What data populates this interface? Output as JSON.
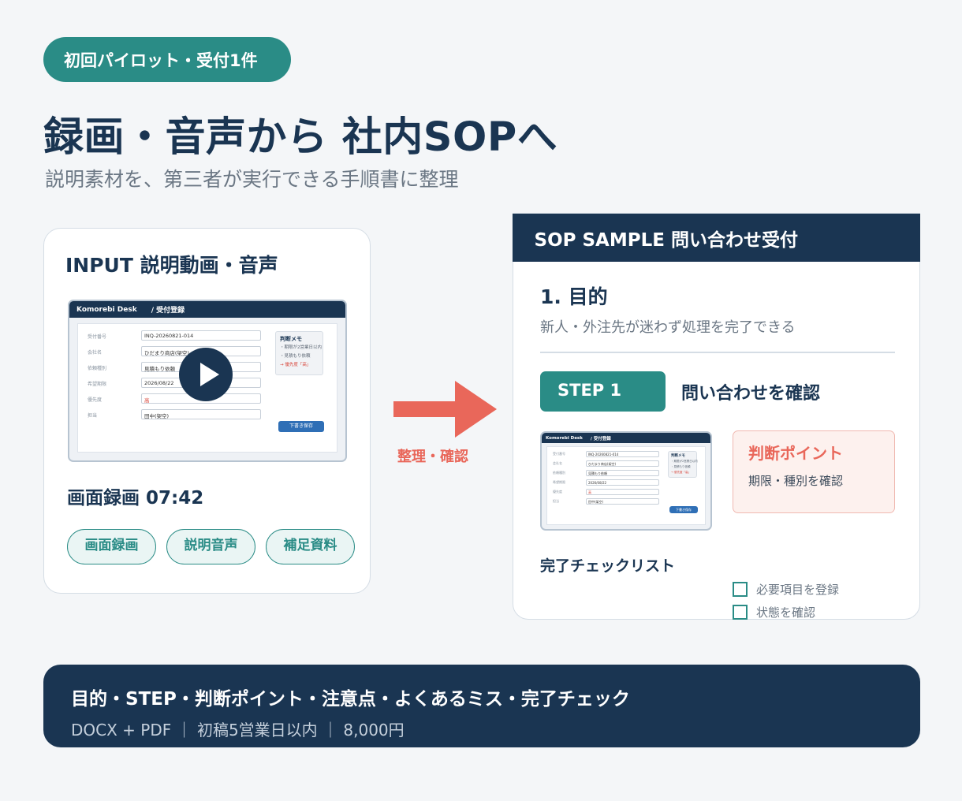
{
  "badge": "初回パイロット・受付1件",
  "headline": "録画・音声から 社内SOPへ",
  "subline": "説明素材を、第三者が実行できる手順書に整理",
  "input": {
    "title": "INPUT  説明動画・音声",
    "duration": "画面録画  07:42",
    "chips": [
      "画面録画",
      "説明音声",
      "補足資料"
    ]
  },
  "app_thumb": {
    "brand": "Komorebi Desk",
    "page": "/ 受付登録",
    "fields": [
      {
        "label": "受付番号",
        "value": "INQ-20260821-014"
      },
      {
        "label": "会社名",
        "value": "ひだまり商店(架空)"
      },
      {
        "label": "依頼種別",
        "value": "見積もり依頼"
      },
      {
        "label": "希望期限",
        "value": "2026/08/22"
      },
      {
        "label": "優先度",
        "value": "高"
      },
      {
        "label": "担当",
        "value": "田中(架空)"
      }
    ],
    "memo_title": "判断メモ",
    "memo_items": [
      "・期限が2営業日以内",
      "・見積もり依頼",
      "→ 優先度「高」"
    ],
    "save_label": "下書き保存"
  },
  "arrow_label": "整理・確認",
  "sop": {
    "header": "SOP SAMPLE  問い合わせ受付",
    "section": "1. 目的",
    "purpose": "新人・外注先が迷わず処理を完了できる",
    "step_label": "STEP 1",
    "step_title": "問い合わせを確認",
    "judgment_title": "判断ポイント",
    "judgment_text": "期限・種別を確認",
    "checklist_title": "完了チェックリスト",
    "checklist": [
      "必要項目を登録",
      "状態を確認"
    ]
  },
  "bottom": {
    "main": "目的・STEP・判断ポイント・注意点・よくあるミス・完了チェック",
    "sub": "DOCX + PDF  ｜  初稿5営業日以内  ｜  8,000円"
  },
  "colors": {
    "navy": "#1a3552",
    "teal": "#2a8c86",
    "coral": "#e9675a",
    "background": "#f4f6f8"
  }
}
